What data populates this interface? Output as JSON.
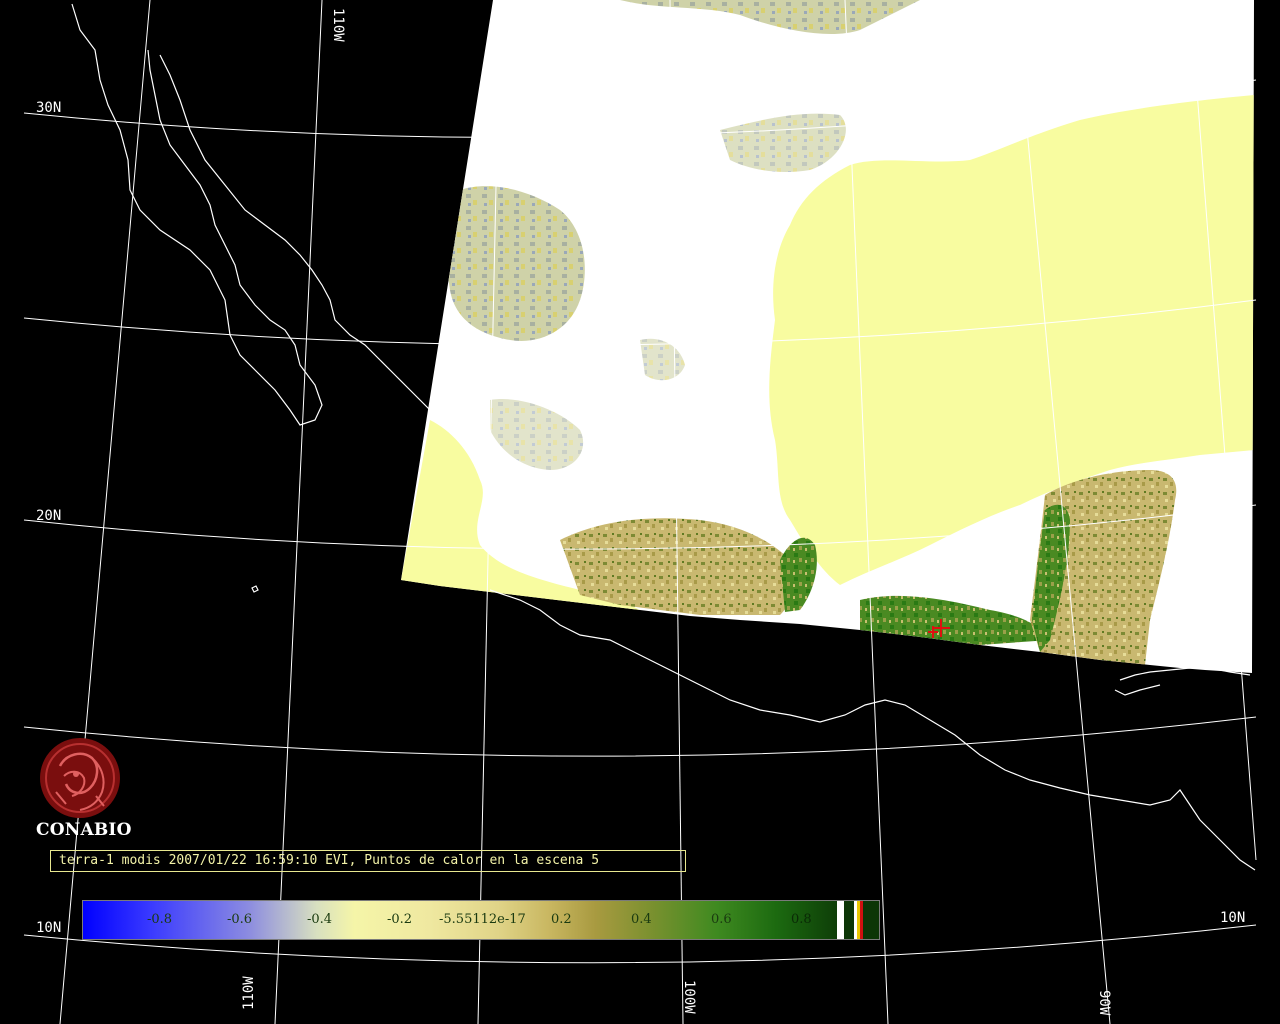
{
  "map": {
    "background_color": "#000000",
    "coastline_color": "#ffffff",
    "grid_color": "#ffffff",
    "scene_color_sea": "#f8fca0",
    "scene_color_cloud": "#ffffff",
    "scene_color_vegetation": "#2e7d14",
    "grid_labels": {
      "lat_30n": "30N",
      "lat_20n_left": "20N",
      "lat_20n_right": "20N",
      "lat_10n_left": "10N",
      "lat_10n_right": "10N",
      "lon_110w_top": "110W",
      "lon_110w_bottom": "110W",
      "lon_100w_bottom": "100W",
      "lon_90w_bottom": "90W"
    },
    "hotspot_marker_color": "#e01010"
  },
  "logo": {
    "name": "CONABIO",
    "icon": "conabio-emblem-icon",
    "color": "#8a1010"
  },
  "caption": {
    "text": "terra-1 modis 2007/01/22 16:59:10 EVI, Puntos de calor en la escena 5"
  },
  "colorbar": {
    "labels": [
      "-0.8",
      "-0.6",
      "-0.4",
      "-0.2",
      "-5.55112e-17",
      "0.2",
      "0.4",
      "0.6",
      "0.8"
    ],
    "stripe_colors": [
      "#ffffff",
      "#0c3606",
      "#ffffff",
      "#e8c800",
      "#d01010"
    ]
  }
}
